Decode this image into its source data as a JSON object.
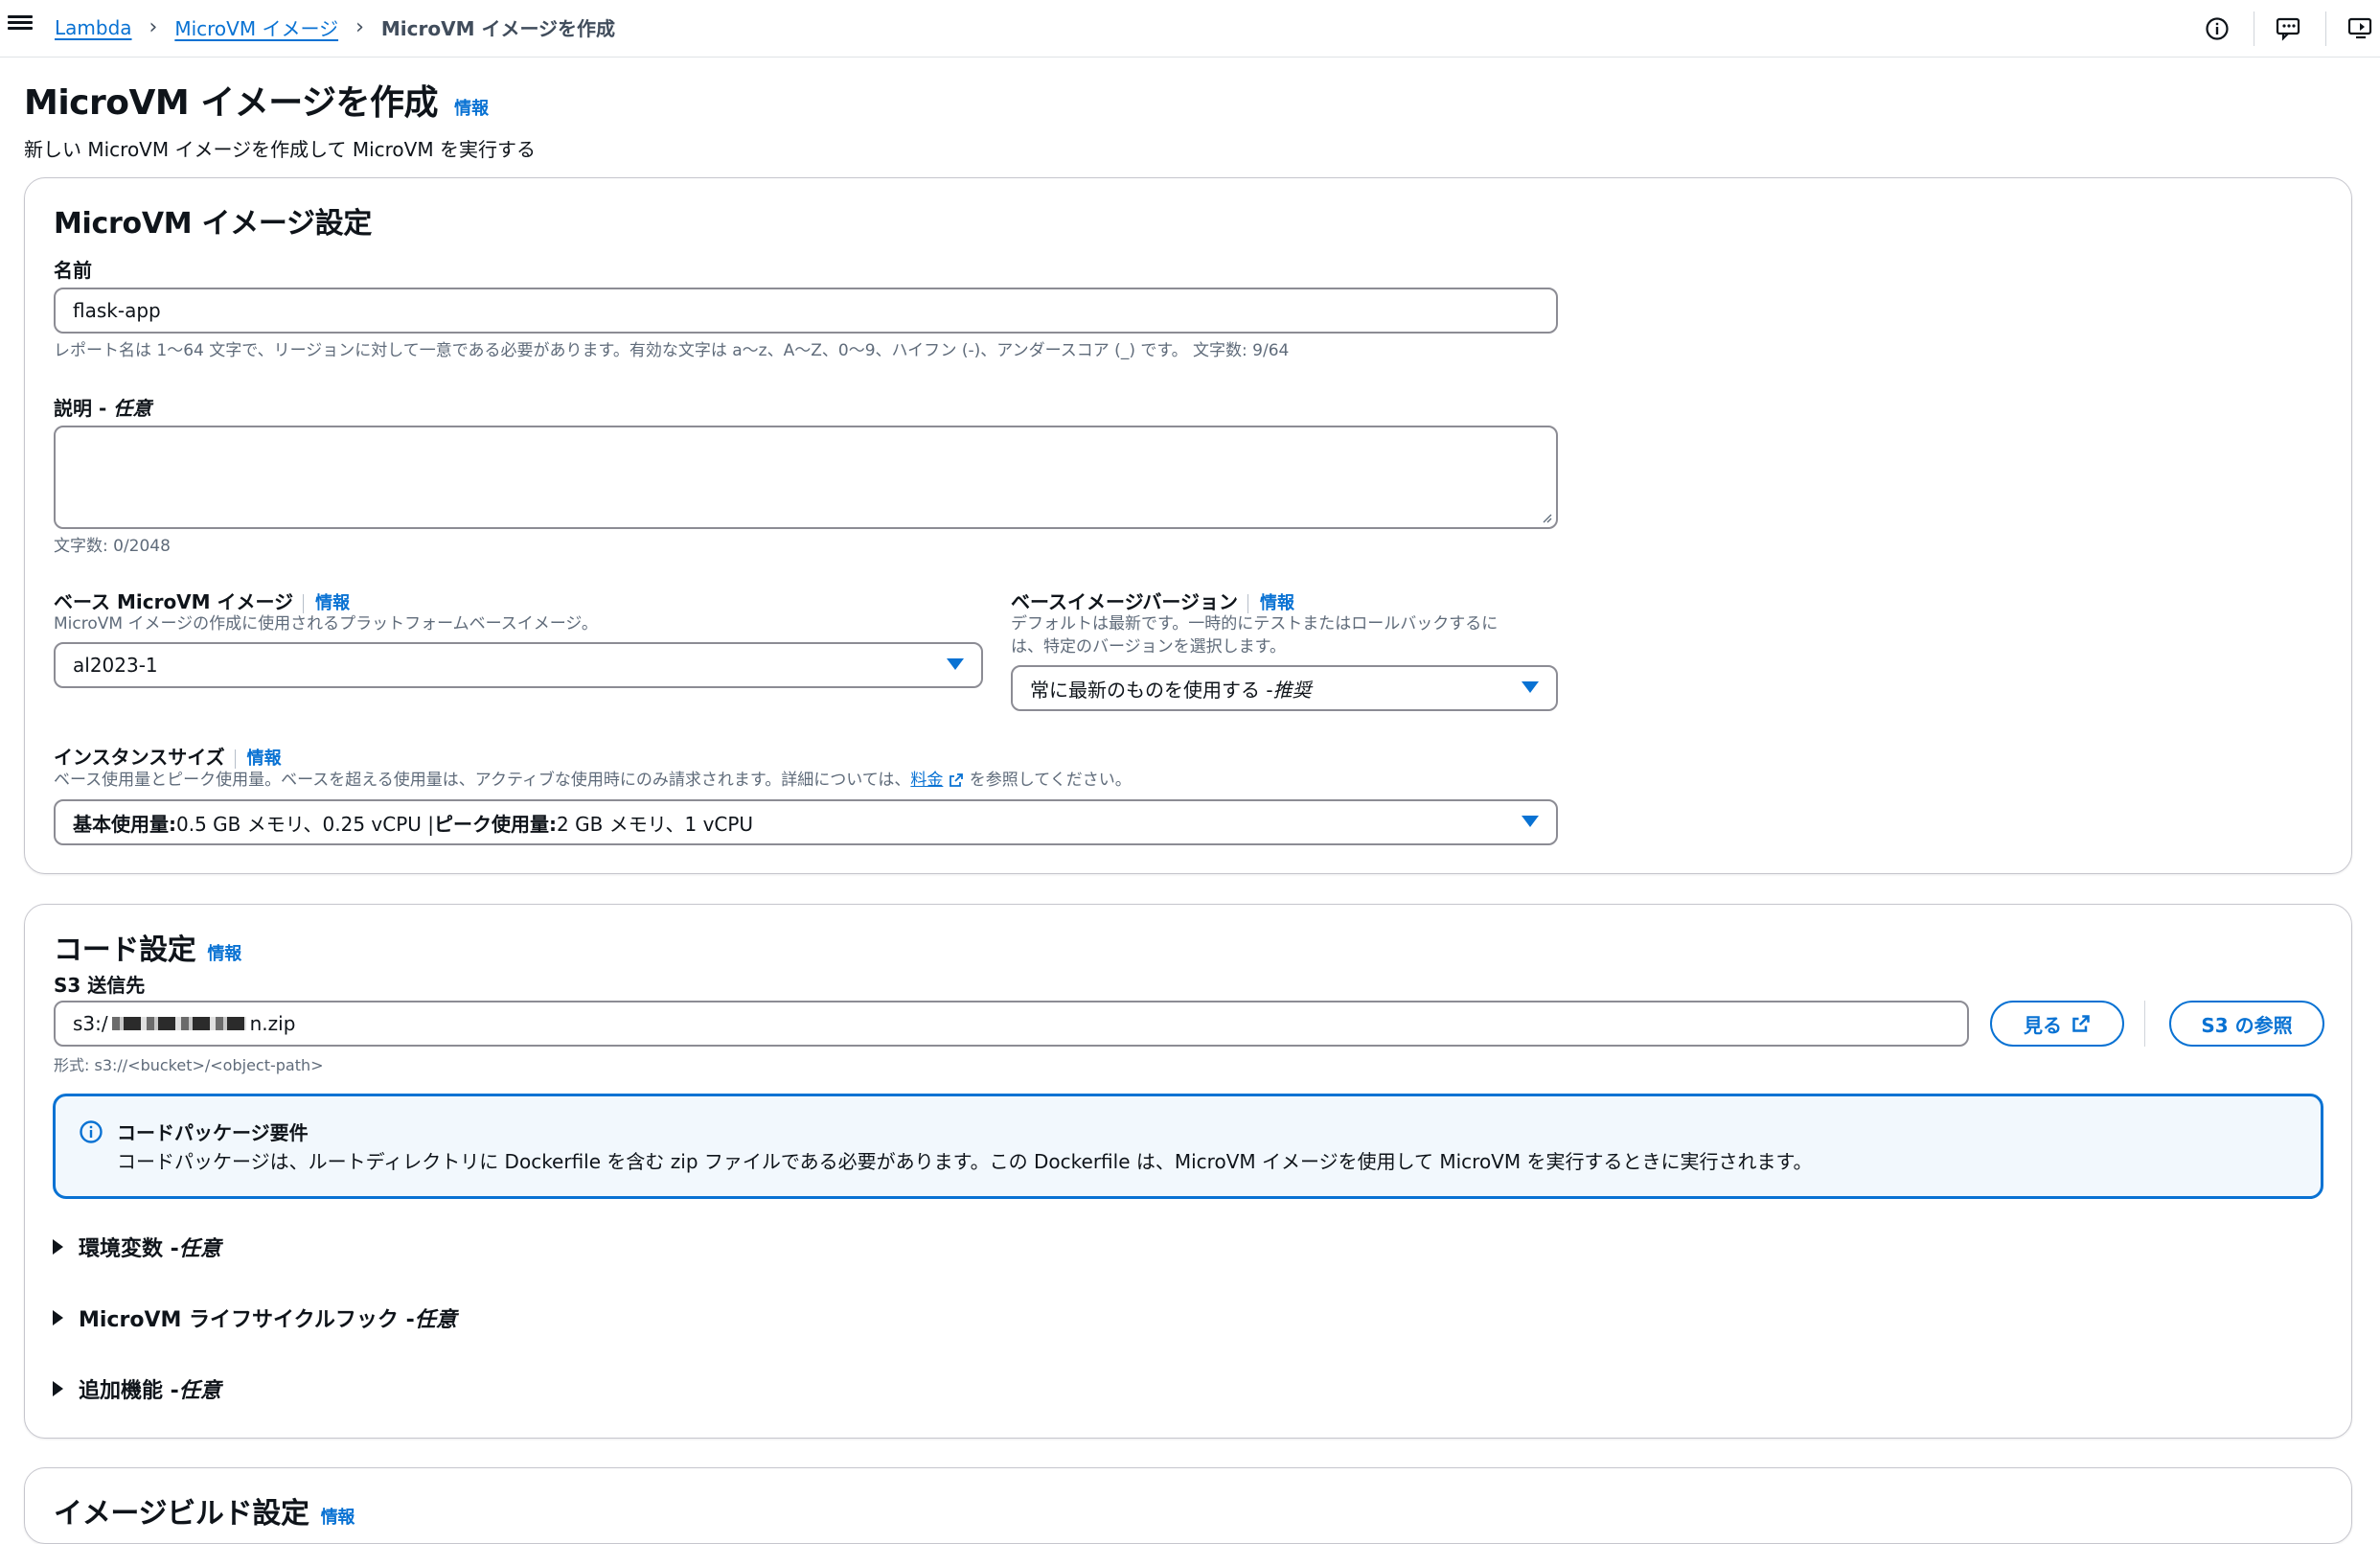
{
  "breadcrumb": {
    "items": [
      "Lambda",
      "MicroVM イメージ"
    ],
    "current": "MicroVM イメージを作成"
  },
  "header": {
    "title": "MicroVM イメージを作成",
    "info": "情報",
    "subtitle": "新しい MicroVM イメージを作成して MicroVM を実行する"
  },
  "image_settings": {
    "title": "MicroVM イメージ設定",
    "name_label": "名前",
    "name_value": "flask-app",
    "name_hint": "レポート名は 1〜64 文字で、リージョンに対して一意である必要があります。有効な文字は a〜z、A〜Z、0〜9、ハイフン (-)、アンダースコア (_) です。 文字数: 9/64",
    "description_label": "説明 - ",
    "description_optional": "任意",
    "description_count": "文字数: 0/2048",
    "base_image_label": "ベース MicroVM イメージ",
    "base_image_info": "情報",
    "base_image_desc": "MicroVM イメージの作成に使用されるプラットフォームベースイメージ。",
    "base_image_value": "al2023-1",
    "base_version_label": "ベースイメージバージョン",
    "base_version_info": "情報",
    "base_version_desc_1": "デフォルトは最新です。一時的にテストまたはロールバックするに",
    "base_version_desc_2": "は、特定のバージョンを選択します。",
    "base_version_value": "常に最新のものを使用する - ",
    "base_version_value_tag": "推奨",
    "instance_size_label": "インスタンスサイズ",
    "instance_size_info": "情報",
    "instance_size_desc_pre": "ベース使用量とピーク使用量。ベースを超える使用量は、アクティブな使用時にのみ請求されます。詳細については、",
    "instance_size_desc_link": "料金",
    "instance_size_desc_post": " を参照してください。",
    "instance_size_base_label": "基本使用量:",
    "instance_size_base_value": " 0.5 GB メモリ、0.25 vCPU | ",
    "instance_size_peak_label": "ピーク使用量:",
    "instance_size_peak_value": " 2 GB メモリ、1 vCPU"
  },
  "code_settings": {
    "title": "コード設定",
    "info": "情報",
    "s3_label": "S3 送信先",
    "s3_value_prefix": "s3:/",
    "s3_value_suffix": "n.zip",
    "s3_format_hint": "形式: s3://<bucket>/<object-path>",
    "view_button": "見る",
    "browse_button": "S3 の参照",
    "alert_title": "コードパッケージ要件",
    "alert_body": "コードパッケージは、ルートディレクトリに Dockerfile を含む zip ファイルである必要があります。この Dockerfile は、MicroVM イメージを使用して MicroVM を実行するときに実行されます。",
    "expanders": [
      {
        "label": "環境変数 - ",
        "optional": "任意"
      },
      {
        "label": "MicroVM ライフサイクルフック - ",
        "optional": "任意"
      },
      {
        "label": "追加機能 - ",
        "optional": "任意"
      }
    ]
  },
  "build_settings": {
    "title": "イメージビルド設定",
    "info": "情報"
  },
  "colors": {
    "link": "#0972d3",
    "text": "#0f141a",
    "muted": "#5f6b7a",
    "alert_bg": "#f2f8fd"
  },
  "icons": [
    "menu-icon",
    "info-circle-icon",
    "feedback-icon",
    "tutorial-icon",
    "external-link-icon",
    "dropdown-caret-icon",
    "expand-triangle-icon"
  ]
}
